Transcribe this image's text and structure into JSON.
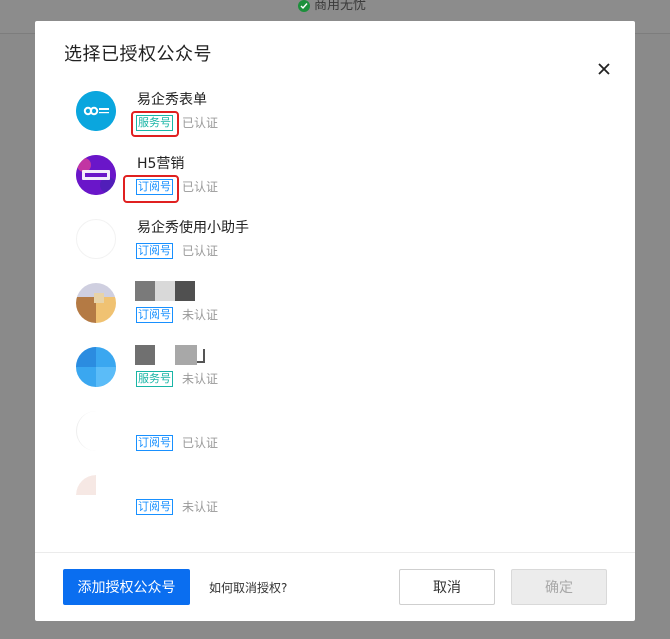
{
  "background": {
    "status_text": "商用无忧"
  },
  "dialog": {
    "title": "选择已授权公众号",
    "accounts": [
      {
        "name": "易企秀表单",
        "type": "服务号",
        "status": "已认证"
      },
      {
        "name": "H5营销",
        "type": "订阅号",
        "status": "已认证"
      },
      {
        "name": "易企秀使用小助手",
        "type": "订阅号",
        "status": "已认证"
      },
      {
        "name": "",
        "type": "订阅号",
        "status": "未认证"
      },
      {
        "name": "",
        "type": "服务号",
        "status": "未认证"
      },
      {
        "name": "",
        "type": "订阅号",
        "status": "已认证"
      },
      {
        "name": "",
        "type": "订阅号",
        "status": "未认证"
      }
    ],
    "footer": {
      "add_button": "添加授权公众号",
      "howto_link": "如何取消授权?",
      "cancel_button": "取消",
      "confirm_button": "确定"
    }
  },
  "colors": {
    "primary": "#0a6ef0",
    "service_tag": "#19b5a6",
    "subscribe_tag": "#1890ff",
    "highlight": "#e02020"
  }
}
